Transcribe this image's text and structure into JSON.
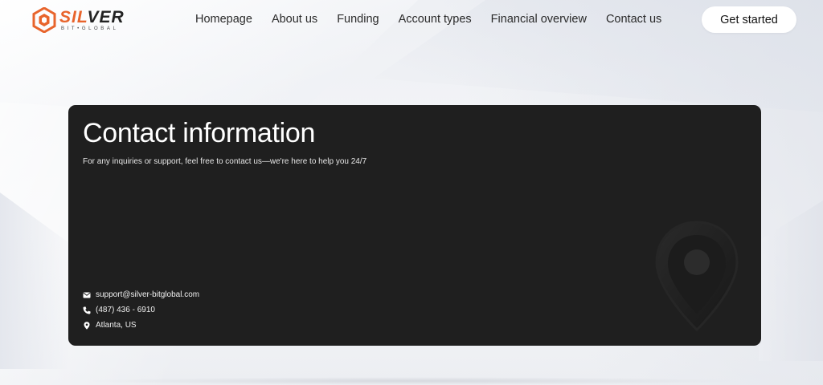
{
  "brand": {
    "name_part1": "SIL",
    "name_part2": "VER",
    "tagline": "BIT•GLOBAL",
    "accent_color": "#e8642c"
  },
  "nav": {
    "items": [
      {
        "label": "Homepage"
      },
      {
        "label": "About us"
      },
      {
        "label": "Funding"
      },
      {
        "label": "Account types"
      },
      {
        "label": "Financial overview"
      },
      {
        "label": "Contact us"
      }
    ],
    "cta_label": "Get started"
  },
  "contact_card": {
    "title": "Contact information",
    "subtitle": "For any inquiries or support, feel free to contact us—we're here to help you 24/7",
    "background_color": "#1f1f1f",
    "decor_icon": "map-pin-icon",
    "items": [
      {
        "icon": "envelope-icon",
        "text": "support@silver-bitglobal.com"
      },
      {
        "icon": "phone-icon",
        "text": "(487) 436 - 6910"
      },
      {
        "icon": "map-pin-icon",
        "text": "Atlanta, US"
      }
    ]
  }
}
